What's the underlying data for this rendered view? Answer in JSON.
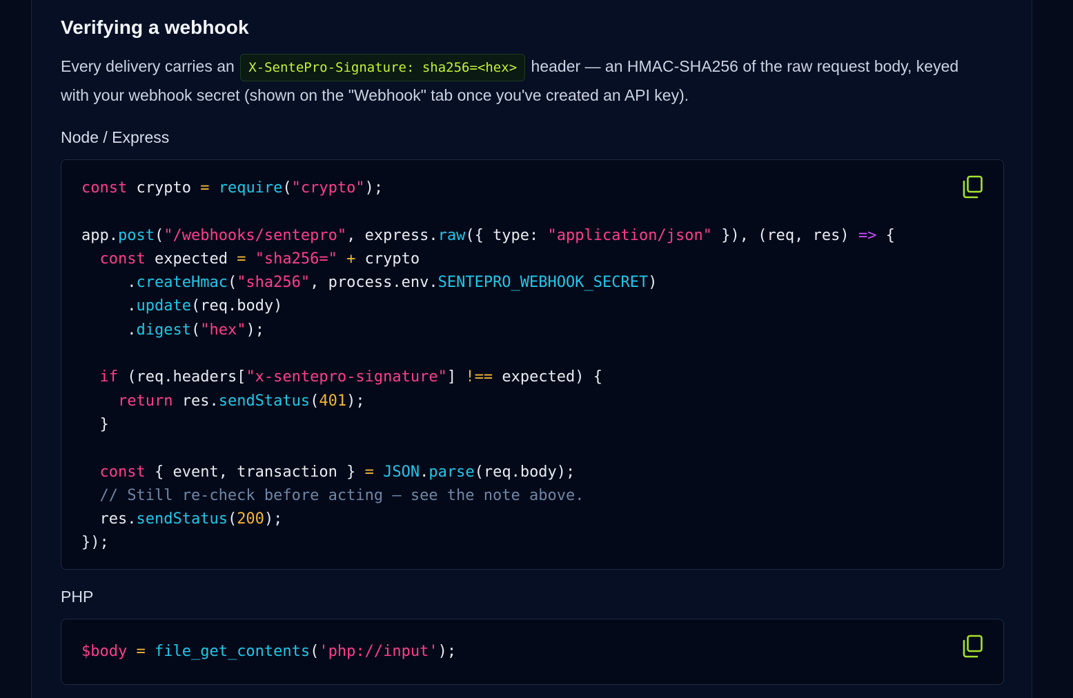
{
  "section": {
    "title": "Verifying a webhook",
    "para_before": "Every delivery carries an",
    "header_code": "X-SentePro-Signature: sha256=<hex>",
    "para_after": "header — an HMAC-SHA256 of the raw request body, keyed with your webhook secret (shown on the \"Webhook\" tab once you've created an API key)."
  },
  "node": {
    "label": "Node / Express",
    "copy_icon": "copy-icon",
    "lines": [
      [
        [
          "k",
          "const"
        ],
        [
          "p",
          " crypto "
        ],
        [
          "o",
          "="
        ],
        [
          "p",
          " "
        ],
        [
          "f",
          "require"
        ],
        [
          "p",
          "("
        ],
        [
          "s",
          "\"crypto\""
        ],
        [
          "p",
          ");"
        ]
      ],
      [],
      [
        [
          "p",
          "app."
        ],
        [
          "f",
          "post"
        ],
        [
          "p",
          "("
        ],
        [
          "s",
          "\"/webhooks/sentepro\""
        ],
        [
          "p",
          ", express."
        ],
        [
          "f",
          "raw"
        ],
        [
          "p",
          "({ type: "
        ],
        [
          "s",
          "\"application/json\""
        ],
        [
          "p",
          " }), (req, res) "
        ],
        [
          "a",
          "=>"
        ],
        [
          "p",
          " {"
        ]
      ],
      [
        [
          "p",
          "  "
        ],
        [
          "k",
          "const"
        ],
        [
          "p",
          " expected "
        ],
        [
          "o",
          "="
        ],
        [
          "p",
          " "
        ],
        [
          "s",
          "\"sha256=\""
        ],
        [
          "p",
          " "
        ],
        [
          "o",
          "+"
        ],
        [
          "p",
          " crypto"
        ]
      ],
      [
        [
          "p",
          "     ."
        ],
        [
          "f",
          "createHmac"
        ],
        [
          "p",
          "("
        ],
        [
          "s",
          "\"sha256\""
        ],
        [
          "p",
          ", process.env."
        ],
        [
          "f",
          "SENTEPRO_WEBHOOK_SECRET"
        ],
        [
          "p",
          ")"
        ]
      ],
      [
        [
          "p",
          "     ."
        ],
        [
          "f",
          "update"
        ],
        [
          "p",
          "(req.body)"
        ]
      ],
      [
        [
          "p",
          "     ."
        ],
        [
          "f",
          "digest"
        ],
        [
          "p",
          "("
        ],
        [
          "s",
          "\"hex\""
        ],
        [
          "p",
          ");"
        ]
      ],
      [],
      [
        [
          "p",
          "  "
        ],
        [
          "k",
          "if"
        ],
        [
          "p",
          " (req.headers["
        ],
        [
          "s",
          "\"x-sentepro-signature\""
        ],
        [
          "p",
          "] "
        ],
        [
          "o",
          "!=="
        ],
        [
          "p",
          " expected) {"
        ]
      ],
      [
        [
          "p",
          "    "
        ],
        [
          "k",
          "return"
        ],
        [
          "p",
          " res."
        ],
        [
          "f",
          "sendStatus"
        ],
        [
          "p",
          "("
        ],
        [
          "n",
          "401"
        ],
        [
          "p",
          ");"
        ]
      ],
      [
        [
          "p",
          "  }"
        ]
      ],
      [],
      [
        [
          "p",
          "  "
        ],
        [
          "k",
          "const"
        ],
        [
          "p",
          " { event, transaction } "
        ],
        [
          "o",
          "="
        ],
        [
          "p",
          " "
        ],
        [
          "f",
          "JSON"
        ],
        [
          "p",
          "."
        ],
        [
          "f",
          "parse"
        ],
        [
          "p",
          "(req.body);"
        ]
      ],
      [
        [
          "c",
          "  // Still re-check before acting — see the note above."
        ]
      ],
      [
        [
          "p",
          "  res."
        ],
        [
          "f",
          "sendStatus"
        ],
        [
          "p",
          "("
        ],
        [
          "n",
          "200"
        ],
        [
          "p",
          ");"
        ]
      ],
      [
        [
          "p",
          "});"
        ]
      ]
    ]
  },
  "php": {
    "label": "PHP",
    "copy_icon": "copy-icon",
    "lines": [
      [
        [
          "v",
          "$body"
        ],
        [
          "p",
          " "
        ],
        [
          "o",
          "="
        ],
        [
          "p",
          " "
        ],
        [
          "f",
          "file_get_contents"
        ],
        [
          "p",
          "("
        ],
        [
          "s",
          "'php://input'"
        ],
        [
          "p",
          ");"
        ]
      ]
    ]
  },
  "colors": {
    "background": "#050b1a",
    "panel": "#060f24",
    "keyword": "#ff3d8f",
    "string": "#ff3d8f",
    "function": "#22c7ea",
    "operator": "#f2b636",
    "number": "#f2b636",
    "arrow": "#c94bff",
    "comment": "#6f86a6",
    "inline_code": "#c6f23a",
    "copy_icon": "#a6e22e"
  }
}
